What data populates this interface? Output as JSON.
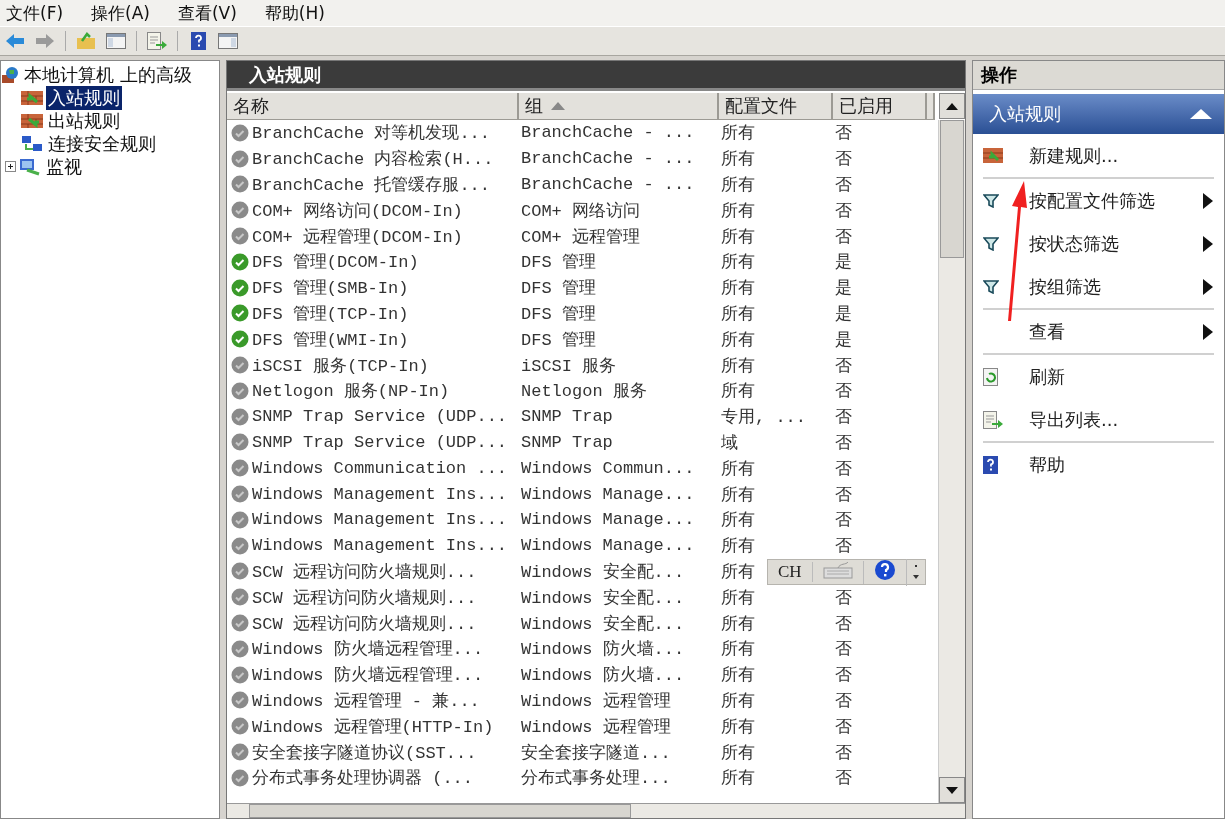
{
  "menu": [
    "文件(F)",
    "操作(A)",
    "查看(V)",
    "帮助(H)"
  ],
  "tree": {
    "label": "本地计算机 上的高级",
    "children": [
      {
        "label": "入站规则",
        "selected": true
      },
      {
        "label": "出站规则",
        "selected": false
      },
      {
        "label": "连接安全规则",
        "selected": false
      },
      {
        "label": "监视",
        "selected": false,
        "expanded": false
      }
    ]
  },
  "panel_title": "入站规则",
  "table": {
    "columns": [
      {
        "label": "名称",
        "sorted": false
      },
      {
        "label": "组",
        "sorted": true
      },
      {
        "label": "配置文件",
        "sorted": false
      },
      {
        "label": "已启用",
        "sorted": false
      }
    ],
    "rows": [
      {
        "name": "BranchCache 对等机发现...",
        "group": "BranchCache - ...",
        "profile": "所有",
        "enabled": "否",
        "on": false
      },
      {
        "name": "BranchCache 内容检索(H...",
        "group": "BranchCache - ...",
        "profile": "所有",
        "enabled": "否",
        "on": false
      },
      {
        "name": "BranchCache 托管缓存服...",
        "group": "BranchCache - ...",
        "profile": "所有",
        "enabled": "否",
        "on": false
      },
      {
        "name": "COM+ 网络访问(DCOM-In)",
        "group": "COM+ 网络访问",
        "profile": "所有",
        "enabled": "否",
        "on": false
      },
      {
        "name": "COM+ 远程管理(DCOM-In)",
        "group": "COM+ 远程管理",
        "profile": "所有",
        "enabled": "否",
        "on": false
      },
      {
        "name": "DFS 管理(DCOM-In)",
        "group": "DFS 管理",
        "profile": "所有",
        "enabled": "是",
        "on": true
      },
      {
        "name": "DFS 管理(SMB-In)",
        "group": "DFS 管理",
        "profile": "所有",
        "enabled": "是",
        "on": true
      },
      {
        "name": "DFS 管理(TCP-In)",
        "group": "DFS 管理",
        "profile": "所有",
        "enabled": "是",
        "on": true
      },
      {
        "name": "DFS 管理(WMI-In)",
        "group": "DFS 管理",
        "profile": "所有",
        "enabled": "是",
        "on": true
      },
      {
        "name": "iSCSI 服务(TCP-In)",
        "group": "iSCSI 服务",
        "profile": "所有",
        "enabled": "否",
        "on": false
      },
      {
        "name": "Netlogon 服务(NP-In)",
        "group": "Netlogon 服务",
        "profile": "所有",
        "enabled": "否",
        "on": false
      },
      {
        "name": "SNMP Trap Service (UDP...",
        "group": "SNMP Trap",
        "profile": "专用, ...",
        "enabled": "否",
        "on": false
      },
      {
        "name": "SNMP Trap Service (UDP...",
        "group": "SNMP Trap",
        "profile": "域",
        "enabled": "否",
        "on": false
      },
      {
        "name": "Windows Communication ...",
        "group": "Windows Commun...",
        "profile": "所有",
        "enabled": "否",
        "on": false
      },
      {
        "name": "Windows Management Ins...",
        "group": "Windows Manage...",
        "profile": "所有",
        "enabled": "否",
        "on": false
      },
      {
        "name": "Windows Management Ins...",
        "group": "Windows Manage...",
        "profile": "所有",
        "enabled": "否",
        "on": false
      },
      {
        "name": "Windows Management Ins...",
        "group": "Windows Manage...",
        "profile": "所有",
        "enabled": "否",
        "on": false
      },
      {
        "name": "SCW 远程访问防火墙规则...",
        "group": "Windows 安全配...",
        "profile": "所有",
        "on": false
      },
      {
        "name": "SCW 远程访问防火墙规则...",
        "group": "Windows 安全配...",
        "profile": "所有",
        "enabled": "否",
        "on": false
      },
      {
        "name": "SCW 远程访问防火墙规则...",
        "group": "Windows 安全配...",
        "profile": "所有",
        "enabled": "否",
        "on": false
      },
      {
        "name": "Windows 防火墙远程管理...",
        "group": "Windows 防火墙...",
        "profile": "所有",
        "enabled": "否",
        "on": false
      },
      {
        "name": "Windows 防火墙远程管理...",
        "group": "Windows 防火墙...",
        "profile": "所有",
        "enabled": "否",
        "on": false
      },
      {
        "name": "Windows 远程管理 - 兼...",
        "group": "Windows 远程管理",
        "profile": "所有",
        "enabled": "否",
        "on": false
      },
      {
        "name": "Windows 远程管理(HTTP-In)",
        "group": "Windows 远程管理",
        "profile": "所有",
        "enabled": "否",
        "on": false
      },
      {
        "name": "安全套接字隧道协议(SST...",
        "group": "安全套接字隧道...",
        "profile": "所有",
        "enabled": "否",
        "on": false
      },
      {
        "name": "分布式事务处理协调器 (...",
        "group": "分布式事务处理...",
        "profile": "所有",
        "enabled": "否",
        "on": false
      }
    ]
  },
  "ime_bar": {
    "language": "CH"
  },
  "actions": {
    "title": "操作",
    "section": {
      "label": "入站规则",
      "expanded": true
    },
    "items": [
      {
        "kind": "item",
        "label": "新建规则...",
        "submenu": false
      },
      {
        "kind": "separator"
      },
      {
        "kind": "item",
        "label": "按配置文件筛选",
        "submenu": true
      },
      {
        "kind": "item",
        "label": "按状态筛选",
        "submenu": true
      },
      {
        "kind": "item",
        "label": "按组筛选",
        "submenu": true
      },
      {
        "kind": "separator"
      },
      {
        "kind": "item",
        "label": "查看",
        "submenu": true
      },
      {
        "kind": "separator"
      },
      {
        "kind": "item",
        "label": "刷新",
        "submenu": false
      },
      {
        "kind": "item",
        "label": "导出列表...",
        "submenu": false
      },
      {
        "kind": "separator"
      },
      {
        "kind": "item",
        "label": "帮助",
        "submenu": false
      }
    ]
  }
}
